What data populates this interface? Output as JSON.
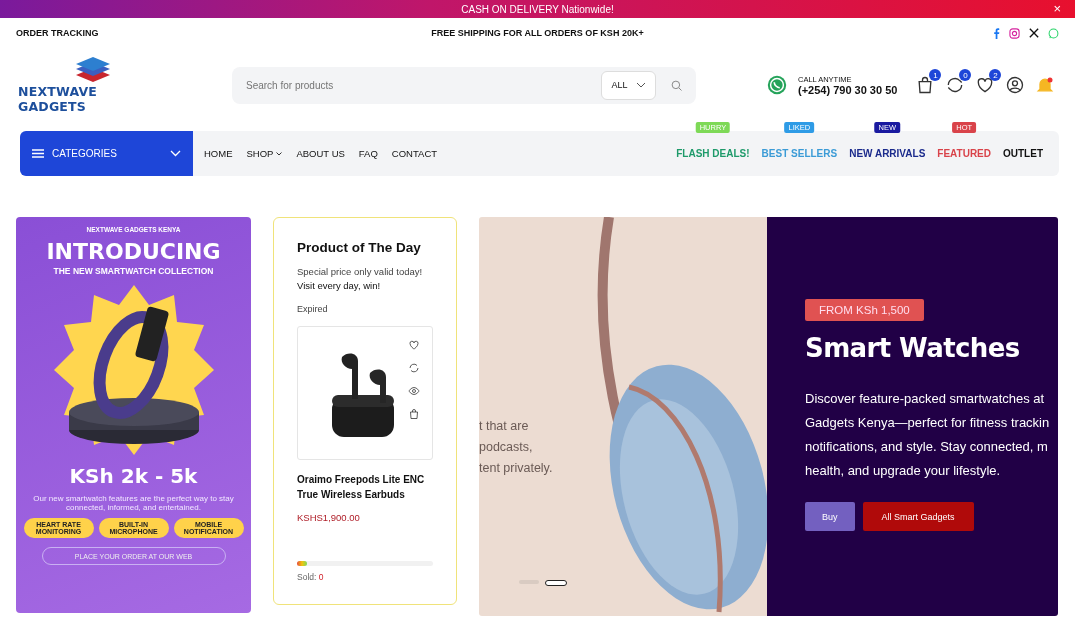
{
  "announcement": {
    "text": "CASH ON DELIVERY Nationwide!",
    "close": "×"
  },
  "topbar": {
    "left": "ORDER TRACKING",
    "center": "FREE SHIPPING FOR ALL ORDERS OF KSH 20K+"
  },
  "logo": {
    "text": "NEXTWAVE GADGETS"
  },
  "search": {
    "placeholder": "Search for products",
    "category": "ALL"
  },
  "contact": {
    "label": "CALL ANYTIME",
    "phone": "(+254) 790 30 30 50"
  },
  "header_icons": [
    {
      "kind": "cart",
      "count": "1"
    },
    {
      "kind": "compare",
      "count": "0"
    },
    {
      "kind": "wishlist",
      "count": "2"
    },
    {
      "kind": "account"
    },
    {
      "kind": "notifications"
    }
  ],
  "categories_button": {
    "label": "CATEGORIES"
  },
  "nav": [
    {
      "label": "HOME",
      "dropdown": false
    },
    {
      "label": "SHOP",
      "dropdown": true
    },
    {
      "label": "ABOUT US",
      "dropdown": false
    },
    {
      "label": "FAQ",
      "dropdown": false
    },
    {
      "label": "CONTACT",
      "dropdown": false
    }
  ],
  "nav_right": [
    {
      "label": "FLASH DEALS!",
      "badge": {
        "text": "HURRY",
        "color": "#7ed957"
      },
      "color": "#1e9a6a"
    },
    {
      "label": "BEST SELLERS",
      "badge": {
        "text": "LIKED",
        "color": "#2e9be6"
      },
      "color": "#3b9bd6"
    },
    {
      "label": "NEW ARRIVALS",
      "badge": {
        "text": "NEW",
        "color": "#1a1aa0"
      },
      "color": "#1a2a8c"
    },
    {
      "label": "FEATURED",
      "badge": {
        "text": "HOT",
        "color": "#d9434a"
      },
      "color": "#d9434a"
    },
    {
      "label": "OUTLET",
      "color": "#111111"
    }
  ],
  "promo_banner": {
    "brand": "NEXTWAVE GADGETS KENYA",
    "headline": "INTRODUCING",
    "subheadline": "THE NEW SMARTWATCH COLLECTION",
    "price": "KSh 2k - 5k",
    "description": "Our new smartwatch features are the perfect way to stay connected, informed, and entertained.",
    "features": [
      "HEART RATE MONITORING",
      "BUILT-IN MICROPHONE",
      "MOBILE NOTIFICATION"
    ],
    "cta": "PLACE YOUR ORDER AT OUR WEB"
  },
  "product_of_day": {
    "title": "Product of The Day",
    "note": "Special price only valid today!",
    "note_bold": "Visit every day, win!",
    "status": "Expired",
    "product": {
      "name": "Oraimo Freepods Lite ENC True Wireless Earbuds",
      "price": "KSHS1,900.00",
      "sold_label": "Sold:",
      "sold_count": "0",
      "level": 0.07
    }
  },
  "hero": {
    "ghost_lines": [
      "t that are",
      "podcasts,",
      "tent privately."
    ],
    "tag": "FROM KSh 1,500",
    "title": "Smart Watches",
    "description_lines": [
      "Discover feature-packed smartwatches at",
      "Gadgets Kenya—perfect for fitness trackin",
      "notifications, and style. Stay connected, m",
      "health, and upgrade your lifestyle."
    ],
    "buttons": [
      {
        "label": "Buy",
        "kind": "primary"
      },
      {
        "label": "All Smart Gadgets",
        "kind": "secondary"
      }
    ],
    "dots": [
      {
        "selected": false
      },
      {
        "selected": true
      }
    ]
  }
}
